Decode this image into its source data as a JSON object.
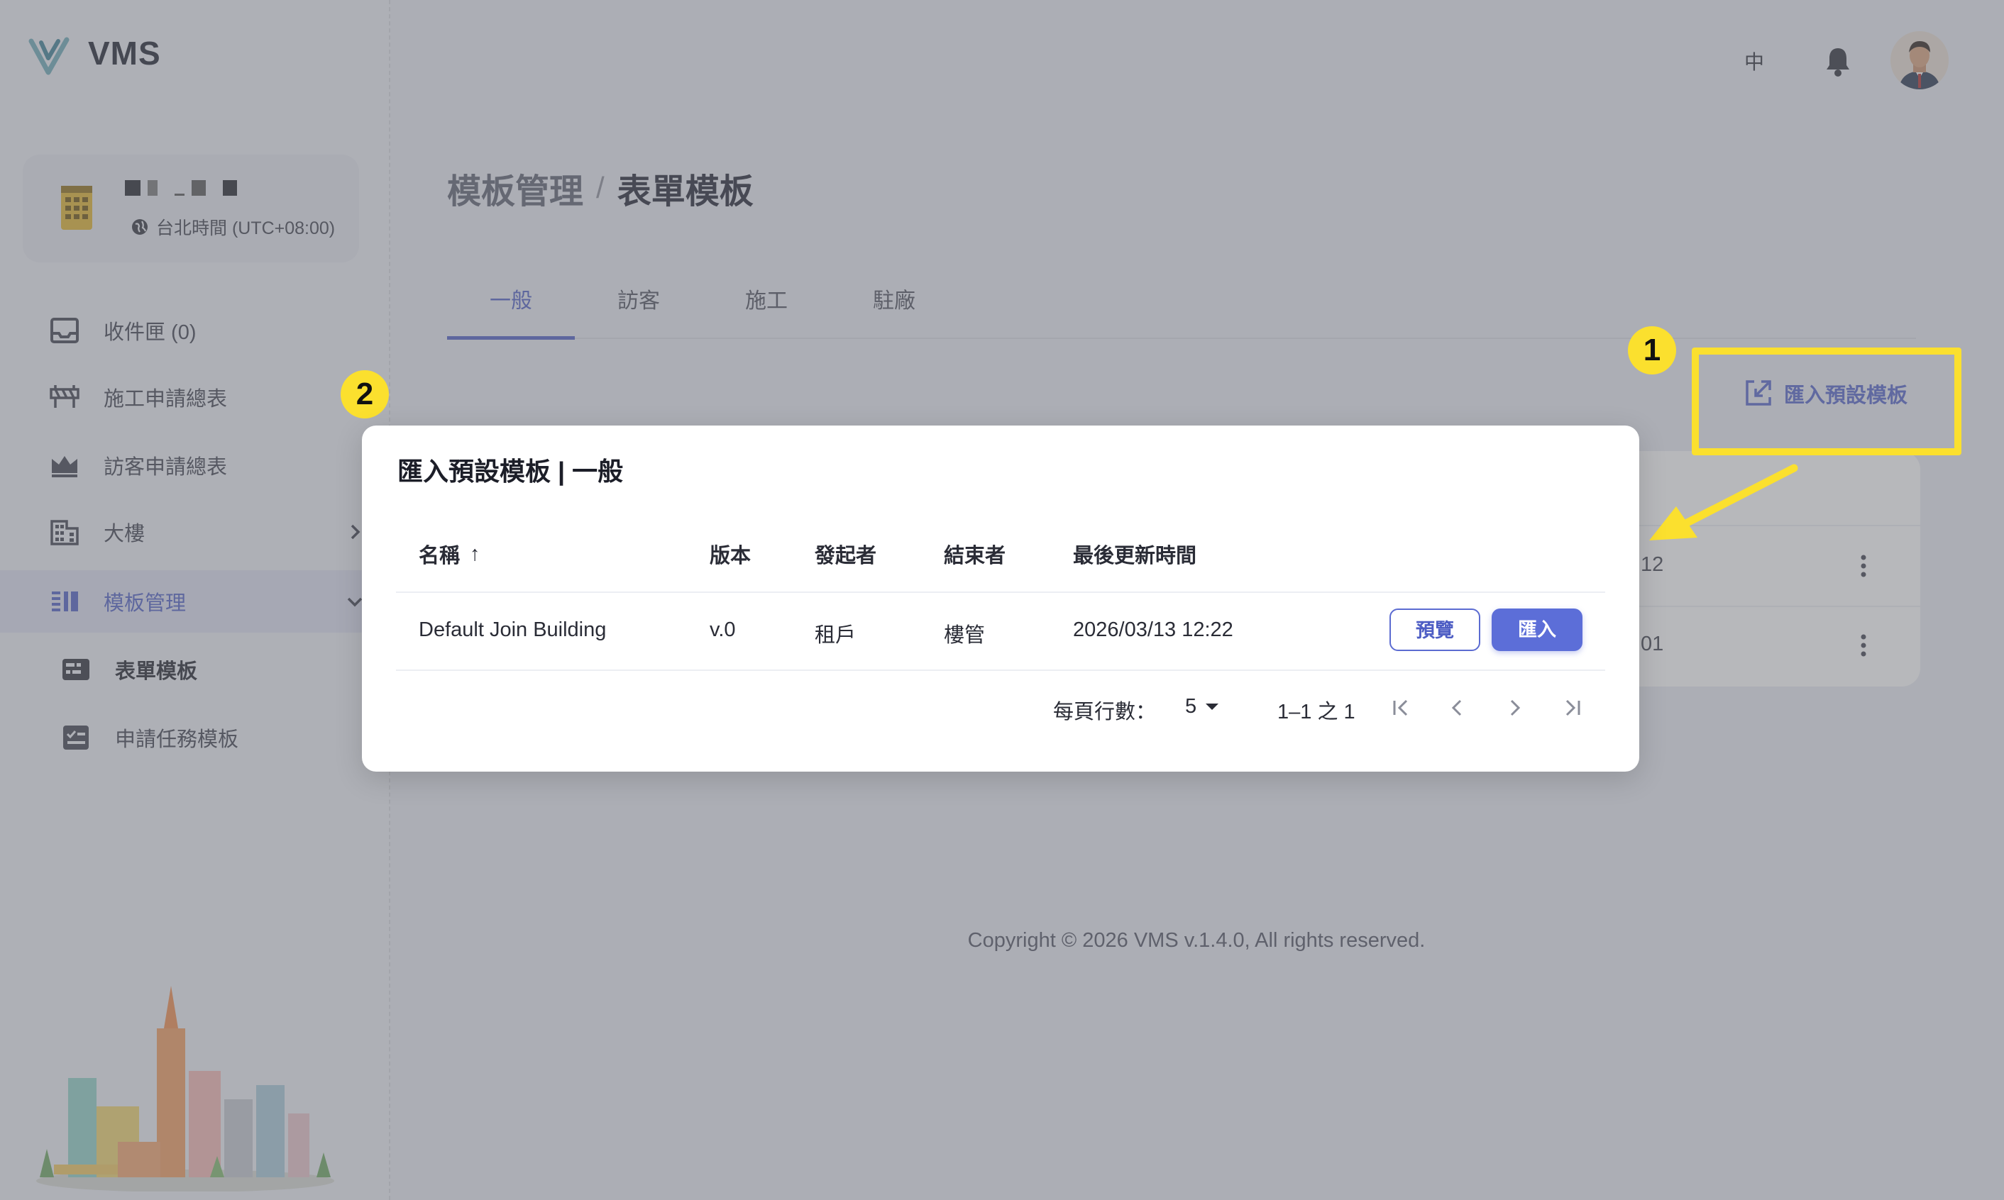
{
  "app": {
    "name": "VMS"
  },
  "building": {
    "timezone": "台北時間 (UTC+08:00)"
  },
  "sidebar": {
    "items": [
      {
        "label": "收件匣 (0)",
        "icon": "inbox-icon"
      },
      {
        "label": "施工申請總表",
        "icon": "barrier-icon"
      },
      {
        "label": "訪客申請總表",
        "icon": "crown-icon"
      },
      {
        "label": "大樓",
        "icon": "building-icon"
      },
      {
        "label": "模板管理",
        "icon": "template-icon",
        "active": true
      }
    ],
    "subitems": [
      {
        "label": "表單模板",
        "icon": "form-icon",
        "active": true
      },
      {
        "label": "申請任務模板",
        "icon": "task-icon"
      }
    ]
  },
  "header": {
    "language": "中"
  },
  "page": {
    "breadcrumb_parent": "模板管理",
    "breadcrumb_separator": "/",
    "breadcrumb_current": "表單模板",
    "tabs": [
      "一般",
      "訪客",
      "施工",
      "駐廠"
    ],
    "active_tab": "一般",
    "import_button_label": "匯入預設模板",
    "background_times": [
      ":12",
      ":01"
    ],
    "copyright": "Copyright © 2026 VMS v.1.4.0, All rights reserved."
  },
  "annotations": {
    "badge_1": "1",
    "badge_2": "2",
    "highlight_color": "#fbe02e"
  },
  "modal": {
    "title": "匯入預設模板 | 一般",
    "columns": [
      "名稱",
      "版本",
      "發起者",
      "結束者",
      "最後更新時間"
    ],
    "sort_indicator": "↑",
    "rows": [
      {
        "name": "Default Join Building",
        "version": "v.0",
        "initiator": "租戶",
        "closer": "樓管",
        "updated": "2026/03/13 12:22"
      }
    ],
    "preview_button": "預覽",
    "import_button": "匯入",
    "pagination": {
      "rows_per_page_label": "每頁行數：",
      "rows_per_page": "5",
      "range": "1–1 之 1"
    }
  },
  "colors": {
    "accent": "#5c6ed8",
    "highlight": "#fbe02e"
  }
}
